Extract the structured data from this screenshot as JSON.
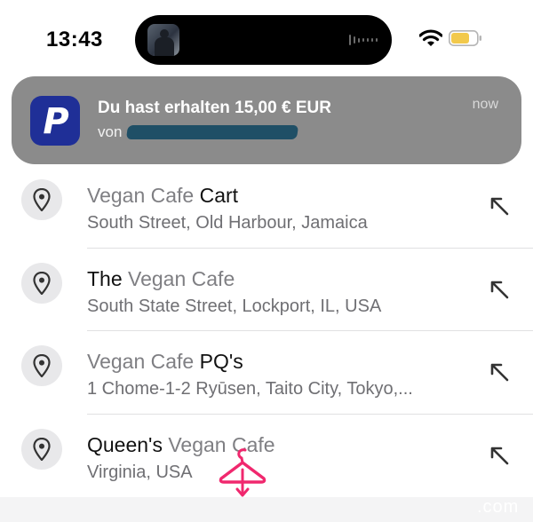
{
  "status_bar": {
    "time": "13:43",
    "icons": [
      "wifi-icon",
      "battery-icon"
    ],
    "battery_color": "#f2c94c"
  },
  "dynamic_island": {
    "icons": [
      "album-art-icon",
      "audio-waveform-icon"
    ]
  },
  "notification": {
    "app_icon": "paypal-icon",
    "title": "Du hast erhalten 15,00 € EUR",
    "body_prefix": "von",
    "time": "now",
    "brand_color": "#1f2f97"
  },
  "results": [
    {
      "title_parts": [
        {
          "text": "Vegan Cafe ",
          "muted": true
        },
        {
          "text": "Cart",
          "muted": false
        }
      ],
      "subtitle": "South Street, Old Harbour, Jamaica",
      "icon": "map-pin-icon",
      "action_icon": "fill-arrow-icon"
    },
    {
      "title_parts": [
        {
          "text": "The ",
          "muted": false
        },
        {
          "text": "Vegan Cafe",
          "muted": true
        }
      ],
      "subtitle": "South State Street, Lockport, IL, USA",
      "icon": "map-pin-icon",
      "action_icon": "fill-arrow-icon"
    },
    {
      "title_parts": [
        {
          "text": "Vegan Cafe ",
          "muted": true
        },
        {
          "text": "PQ's",
          "muted": false
        }
      ],
      "subtitle": "1 Chome-1-2 Ryūsen, Taito City, Tokyo,...",
      "icon": "map-pin-icon",
      "action_icon": "fill-arrow-icon"
    },
    {
      "title_parts": [
        {
          "text": "Queen's ",
          "muted": false
        },
        {
          "text": "Vegan Cafe",
          "muted": true
        }
      ],
      "subtitle": "Virginia, USA",
      "icon": "map-pin-icon",
      "action_icon": "fill-arrow-icon"
    }
  ],
  "watermark": {
    "icon": "hanger-logo-icon",
    "text": ".com",
    "color": "#f0286e"
  }
}
